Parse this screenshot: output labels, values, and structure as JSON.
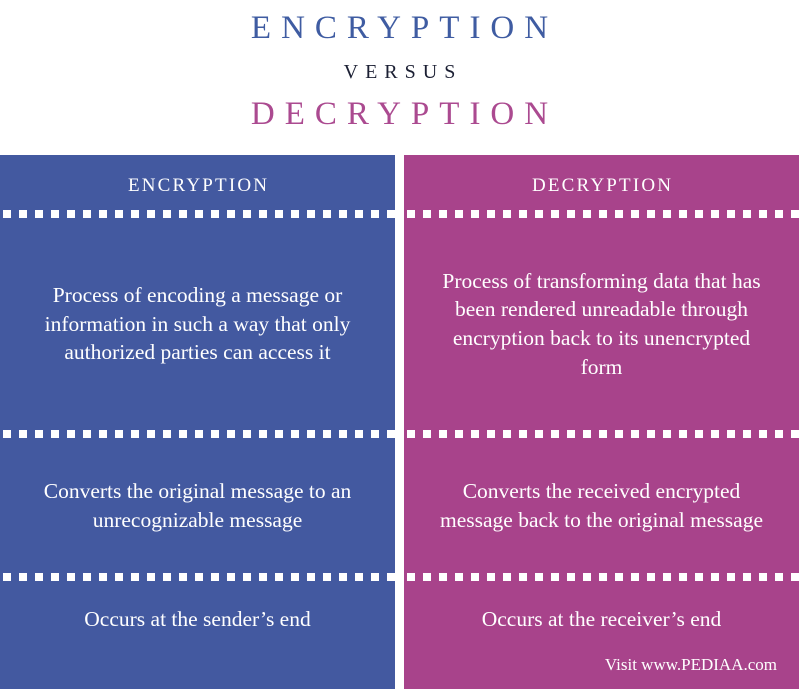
{
  "title": {
    "term_a": "ENCRYPTION",
    "versus": "VERSUS",
    "term_b": "DECRYPTION"
  },
  "colors": {
    "encryption_title": "#3f5ca2",
    "decryption_title": "#ab4a90",
    "versus_title": "#1b1f33",
    "encryption_panel": "#4359a0",
    "decryption_panel": "#a8438b",
    "text": "#ffffff",
    "background": "#ffffff"
  },
  "comparison": {
    "headers": [
      "ENCRYPTION",
      "DECRYPTION"
    ],
    "rows": [
      {
        "encryption": "Process of encoding a message or information in such a way that only authorized parties can access it",
        "decryption": "Process of transforming data that has been rendered unreadable through encryption back to its unencrypted form"
      },
      {
        "encryption": "Converts the original message to an unrecognizable message",
        "decryption": "Converts the received encrypted message back to the original message"
      },
      {
        "encryption": "Occurs at the sender’s end",
        "decryption": "Occurs at the receiver’s end"
      }
    ]
  },
  "footer": {
    "credit": "Visit www.PEDIAA.com"
  }
}
